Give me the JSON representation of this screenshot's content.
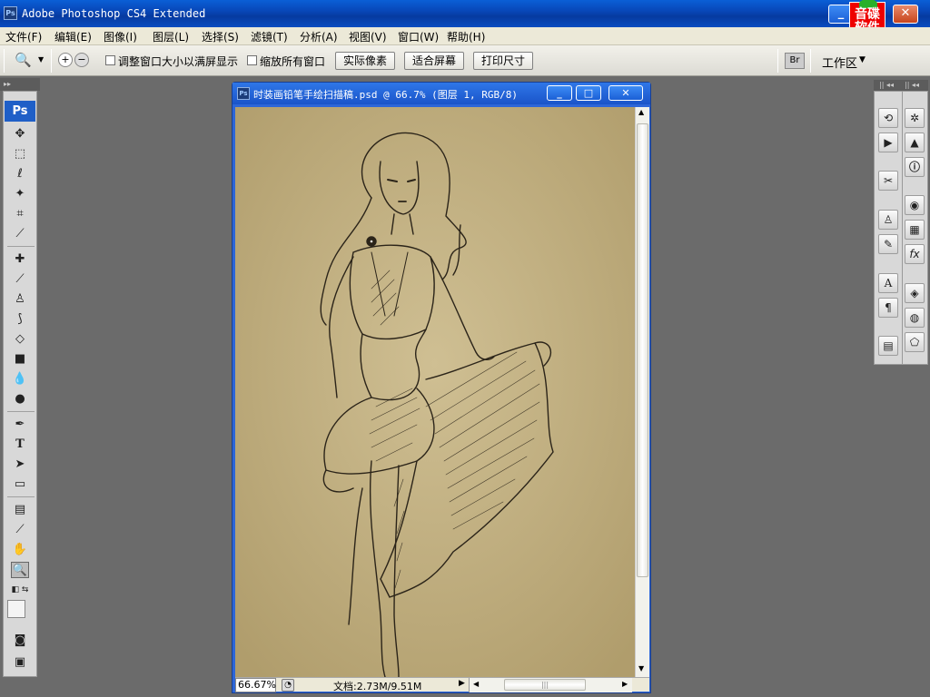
{
  "app": {
    "icon_text": "Ps",
    "title": "Adobe Photoshop CS4 Extended",
    "logo_text": "音碟\n软件"
  },
  "menu": [
    "文件(F)",
    "编辑(E)",
    "图像(I)",
    "图层(L)",
    "选择(S)",
    "滤镜(T)",
    "分析(A)",
    "视图(V)",
    "窗口(W)",
    "帮助(H)"
  ],
  "options": {
    "resize_windows_label": "调整窗口大小以满屏显示",
    "zoom_all_label": "缩放所有窗口",
    "actual_pixels": "实际像素",
    "fit_screen": "适合屏幕",
    "print_size": "打印尺寸",
    "workspace": "工作区"
  },
  "tools": {
    "logo": "Ps"
  },
  "document": {
    "icon_text": "Ps",
    "title": "时装画铅笔手绘扫描稿.psd @ 66.7% (图层 1, RGB/8)",
    "zoom": "66.67%",
    "doc_info": "文档:2.73M/9.51M"
  },
  "colors": {
    "accent": "#1f5fc7",
    "canvas_paper": "#c4b386",
    "workspace_bg": "#6b6b6b"
  }
}
